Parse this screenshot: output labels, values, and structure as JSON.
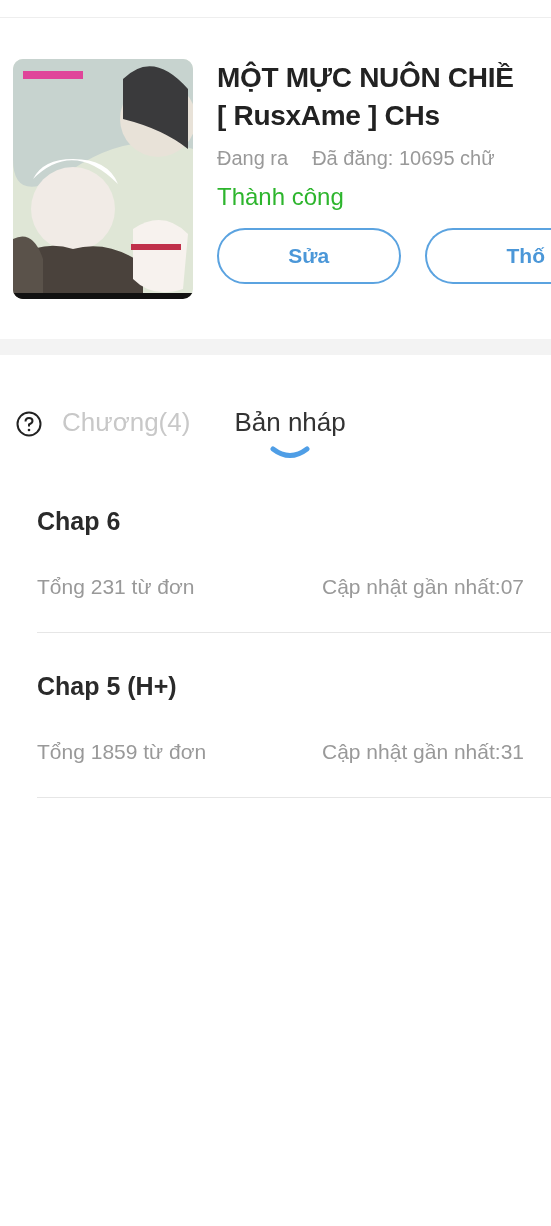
{
  "book": {
    "title_lines": [
      "MỘT MỰC NUÔN CHIỀ",
      "[ RusxAme ] CHs"
    ],
    "status": "Đang ra",
    "published": "Đã đăng: 10695 chữ",
    "result": "Thành công",
    "buttons": [
      "Sửa",
      "Thố"
    ]
  },
  "tabs": [
    {
      "label": "Chương(4)",
      "selected": false
    },
    {
      "label": "Bản nháp",
      "selected": true
    }
  ],
  "drafts": [
    {
      "title": "Chap 6",
      "words": "Tổng 231 từ đơn",
      "updated": "Cập nhật gần nhất:07"
    },
    {
      "title": "Chap 5 (H+)",
      "words": "Tổng 1859 từ đơn",
      "updated": "Cập nhật gần nhất:31"
    }
  ]
}
